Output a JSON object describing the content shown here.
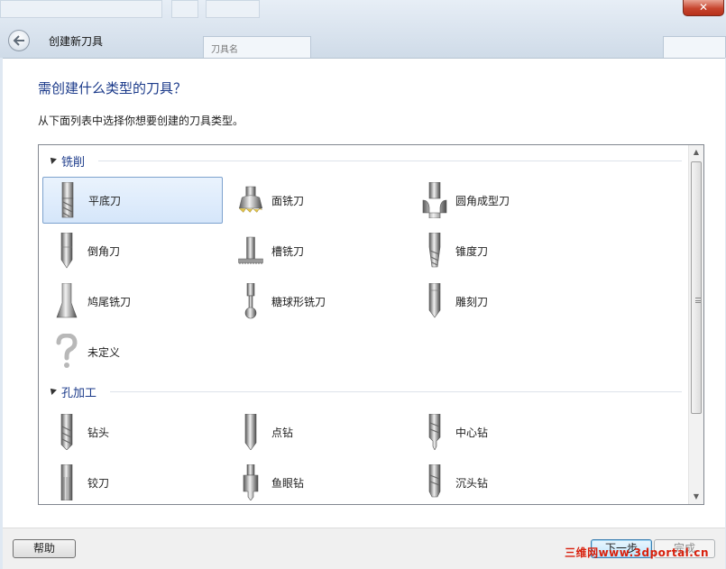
{
  "window": {
    "title": "创建新刀具",
    "close_glyph": "✕"
  },
  "background": {
    "tab_label": "刀具名"
  },
  "dialog": {
    "heading": "需创建什么类型的刀具？",
    "subtext": "从下面列表中选择你想要创建的刀具类型。"
  },
  "groups": [
    {
      "label": "铣削",
      "items": [
        {
          "label": "平底刀",
          "icon": "flat-end-mill-icon",
          "selected": true
        },
        {
          "label": "面铣刀",
          "icon": "face-mill-icon"
        },
        {
          "label": "圆角成型刀",
          "icon": "corner-round-icon"
        },
        {
          "label": "倒角刀",
          "icon": "chamfer-mill-icon"
        },
        {
          "label": "槽铣刀",
          "icon": "slot-mill-icon"
        },
        {
          "label": "锥度刀",
          "icon": "taper-mill-icon"
        },
        {
          "label": "鸠尾铣刀",
          "icon": "dovetail-mill-icon"
        },
        {
          "label": "糖球形铣刀",
          "icon": "lollipop-mill-icon"
        },
        {
          "label": "雕刻刀",
          "icon": "engrave-tool-icon"
        },
        {
          "label": "未定义",
          "icon": "question-mark-icon"
        }
      ]
    },
    {
      "label": "孔加工",
      "items": [
        {
          "label": "钻头",
          "icon": "drill-icon"
        },
        {
          "label": "点钻",
          "icon": "spot-drill-icon"
        },
        {
          "label": "中心钻",
          "icon": "center-drill-icon"
        },
        {
          "label": "铰刀",
          "icon": "reamer-icon"
        },
        {
          "label": "鱼眼钻",
          "icon": "counterbore-icon"
        },
        {
          "label": "沉头钻",
          "icon": "countersink-icon"
        }
      ]
    }
  ],
  "footer": {
    "help": "帮助",
    "next": "下一步",
    "finish": "完成",
    "watermark": "三维网www.3dportal.cn"
  }
}
